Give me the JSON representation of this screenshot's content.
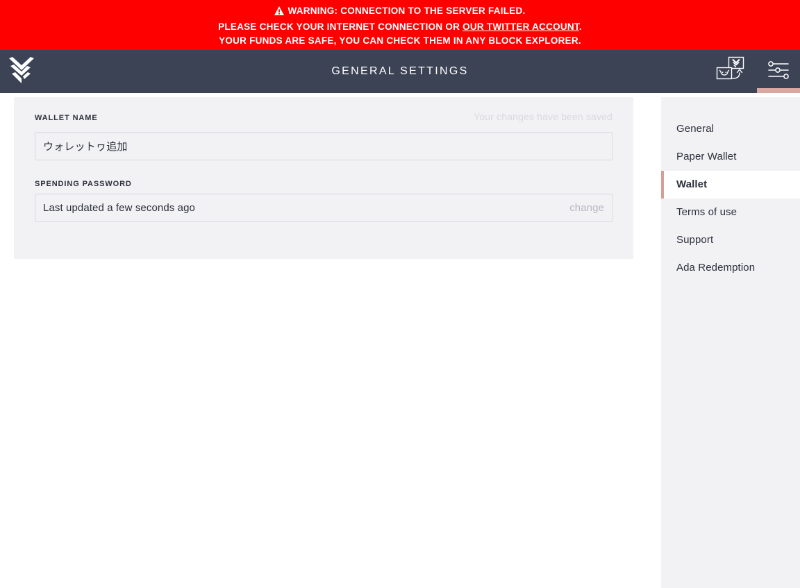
{
  "warning": {
    "icon": "warning-triangle-icon",
    "line1": "WARNING: CONNECTION TO THE SERVER FAILED.",
    "line2_prefix": "PLEASE CHECK YOUR INTERNET CONNECTION OR ",
    "line2_link": "OUR TWITTER ACCOUNT",
    "line2_suffix": ".",
    "line3": "YOUR FUNDS ARE SAFE, YOU CAN CHECK THEM IN ANY BLOCK EXPLORER.",
    "background_color": "#ff0000",
    "text_color": "#ffffff"
  },
  "topbar": {
    "logo_icon": "daedalus-logo-icon",
    "title": "GENERAL SETTINGS",
    "background_color": "#3c4355",
    "actions": [
      {
        "icon": "wallet-switch-icon",
        "label": "",
        "active": false
      },
      {
        "icon": "settings-sliders-icon",
        "label": "",
        "active": true
      }
    ],
    "active_indicator_color": "#d9a8a0"
  },
  "settings": {
    "wallet_name": {
      "label": "WALLET NAME",
      "value": "ウォレットヮ追加",
      "placeholder": "",
      "codepoints": [
        "30A6",
        "30A9",
        "30EC",
        "30C3",
        "30C8",
        "30EE",
        "8FFD",
        "52A0"
      ]
    },
    "saved_message": "Your changes have been saved",
    "spending_password": {
      "label": "SPENDING PASSWORD",
      "status": "Last updated a few seconds ago",
      "change_label": "change"
    },
    "panel_background": "#f2f2f4"
  },
  "settings_menu": {
    "items": [
      {
        "label": "General",
        "active": false
      },
      {
        "label": "Paper Wallet",
        "active": false
      },
      {
        "label": "Wallet",
        "active": true
      },
      {
        "label": "Terms of use",
        "active": false
      },
      {
        "label": "Support",
        "active": false
      },
      {
        "label": "Ada Redemption",
        "active": false
      }
    ],
    "active_border_color": "#d2a097"
  }
}
